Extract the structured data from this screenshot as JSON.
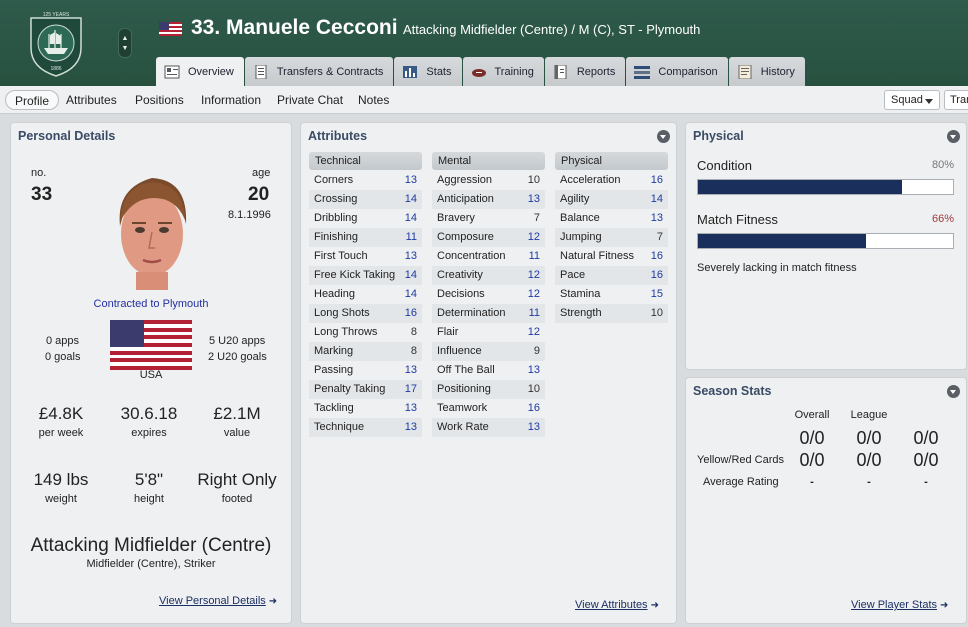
{
  "header": {
    "player_name": "33. Manuele Cecconi",
    "player_role": "Attacking Midfielder (Centre) / M (C), ST - Plymouth",
    "crest_text": "125 YEARS",
    "crest_year": "1886"
  },
  "tabs": [
    {
      "label": "Overview",
      "icon": "overview-icon"
    },
    {
      "label": "Transfers & Contracts",
      "icon": "document-icon"
    },
    {
      "label": "Stats",
      "icon": "stats-icon"
    },
    {
      "label": "Training",
      "icon": "training-icon"
    },
    {
      "label": "Reports",
      "icon": "reports-icon"
    },
    {
      "label": "Comparison",
      "icon": "comparison-icon"
    },
    {
      "label": "History",
      "icon": "history-icon"
    }
  ],
  "subnav": {
    "items": [
      "Profile",
      "Attributes",
      "Positions",
      "Information",
      "Private Chat",
      "Notes"
    ],
    "squad_label": "Squad",
    "transfer_label": "Tran"
  },
  "personal": {
    "title": "Personal Details",
    "no_label": "no.",
    "no_value": "33",
    "age_label": "age",
    "age_value": "20",
    "dob": "8.1.1996",
    "contract": "Contracted to Plymouth",
    "apps": "0 apps",
    "goals": "0 goals",
    "u20_apps": "5 U20 apps",
    "u20_goals": "2 U20 goals",
    "nation": "USA",
    "wage": "£4.8K",
    "wage_label": "per week",
    "expires": "30.6.18",
    "expires_label": "expires",
    "value": "£2.1M",
    "value_label": "value",
    "weight": "149 lbs",
    "weight_label": "weight",
    "height": "5'8\"",
    "height_label": "height",
    "foot": "Right Only",
    "foot_label": "footed",
    "position": "Attacking Midfielder (Centre)",
    "positions_sub": "Midfielder (Centre), Striker",
    "link": "View Personal Details"
  },
  "attributes": {
    "title": "Attributes",
    "technical_head": "Technical",
    "mental_head": "Mental",
    "physical_head": "Physical",
    "technical": [
      {
        "name": "Corners",
        "value": "13"
      },
      {
        "name": "Crossing",
        "value": "14"
      },
      {
        "name": "Dribbling",
        "value": "14"
      },
      {
        "name": "Finishing",
        "value": "11"
      },
      {
        "name": "First Touch",
        "value": "13"
      },
      {
        "name": "Free Kick Taking",
        "value": "14"
      },
      {
        "name": "Heading",
        "value": "14"
      },
      {
        "name": "Long Shots",
        "value": "16"
      },
      {
        "name": "Long Throws",
        "value": "8"
      },
      {
        "name": "Marking",
        "value": "8"
      },
      {
        "name": "Passing",
        "value": "13"
      },
      {
        "name": "Penalty Taking",
        "value": "17"
      },
      {
        "name": "Tackling",
        "value": "13"
      },
      {
        "name": "Technique",
        "value": "13"
      }
    ],
    "mental": [
      {
        "name": "Aggression",
        "value": "10"
      },
      {
        "name": "Anticipation",
        "value": "13"
      },
      {
        "name": "Bravery",
        "value": "7"
      },
      {
        "name": "Composure",
        "value": "12"
      },
      {
        "name": "Concentration",
        "value": "11"
      },
      {
        "name": "Creativity",
        "value": "12"
      },
      {
        "name": "Decisions",
        "value": "12"
      },
      {
        "name": "Determination",
        "value": "11"
      },
      {
        "name": "Flair",
        "value": "12"
      },
      {
        "name": "Influence",
        "value": "9"
      },
      {
        "name": "Off The Ball",
        "value": "13"
      },
      {
        "name": "Positioning",
        "value": "10"
      },
      {
        "name": "Teamwork",
        "value": "16"
      },
      {
        "name": "Work Rate",
        "value": "13"
      }
    ],
    "physical": [
      {
        "name": "Acceleration",
        "value": "16"
      },
      {
        "name": "Agility",
        "value": "14"
      },
      {
        "name": "Balance",
        "value": "13"
      },
      {
        "name": "Jumping",
        "value": "7"
      },
      {
        "name": "Natural Fitness",
        "value": "16"
      },
      {
        "name": "Pace",
        "value": "16"
      },
      {
        "name": "Stamina",
        "value": "15"
      },
      {
        "name": "Strength",
        "value": "10"
      }
    ],
    "link": "View Attributes"
  },
  "physical": {
    "title": "Physical",
    "condition_label": "Condition",
    "condition_value": "80%",
    "condition_fill": 0.8,
    "fitness_label": "Match Fitness",
    "fitness_value": "66%",
    "fitness_fill": 0.66,
    "note": "Severely lacking in match fitness",
    "colors": {
      "bar": "#1a2f5c",
      "good": "#777777",
      "bad": "#a33b3b"
    }
  },
  "season": {
    "title": "Season Stats",
    "col_overall": "Overall",
    "col_league": "League",
    "col_third": "",
    "row_apps": [
      "0/0",
      "0/0",
      "0/0"
    ],
    "row_cards_label": "Yellow/Red Cards",
    "row_cards": [
      "0/0",
      "0/0",
      "0/0"
    ],
    "row_rating_label": "Average Rating",
    "row_rating": [
      "-",
      "-",
      "-"
    ],
    "link": "View Player Stats"
  }
}
